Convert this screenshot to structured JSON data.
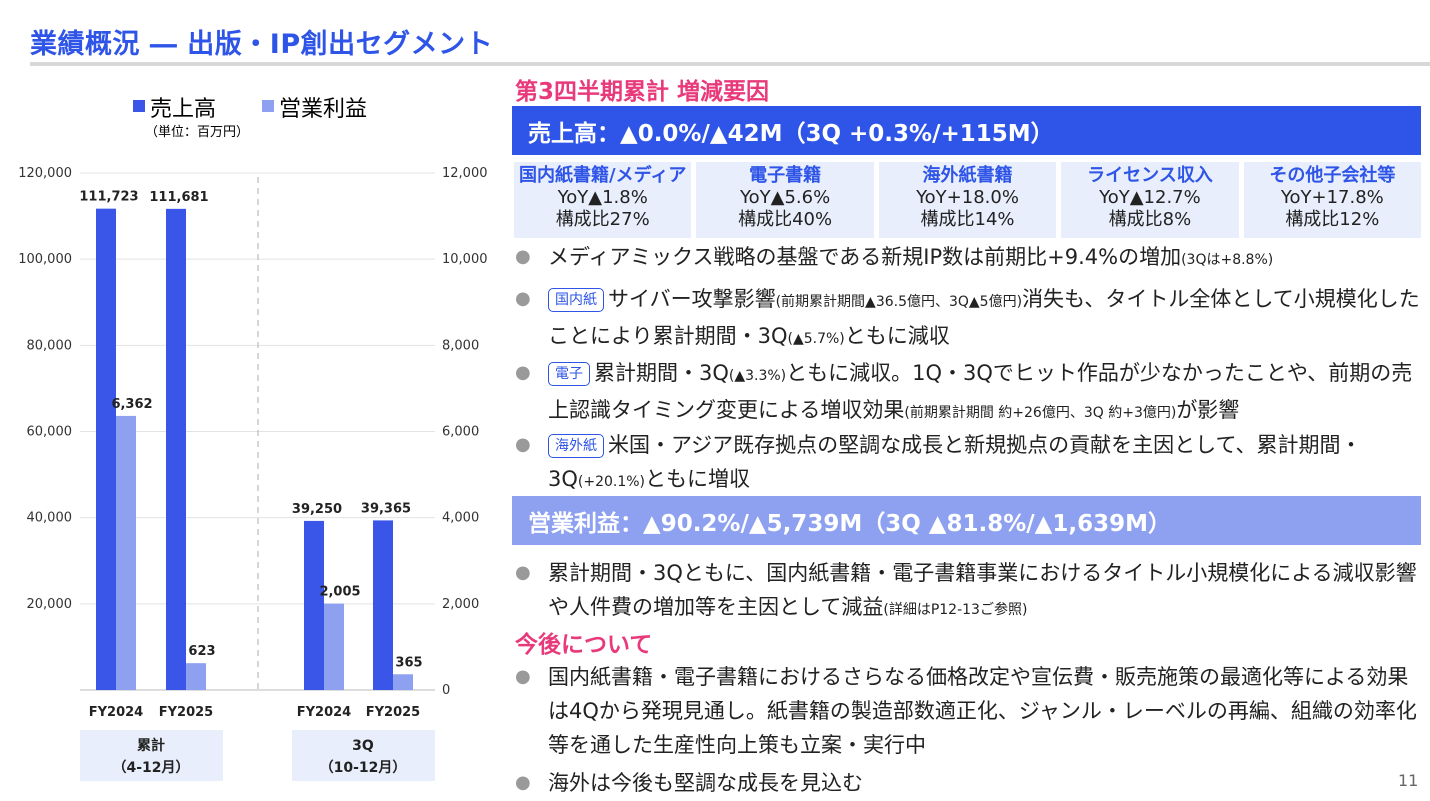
{
  "title": "業績概況 ― 出版・IP創出セグメント",
  "chart": {
    "legend": [
      {
        "name": "売上高",
        "color": "#3a56e8"
      },
      {
        "name": "営業利益",
        "color": "#8ea1f0"
      }
    ],
    "unit": "（単位：百万円）",
    "groups": [
      {
        "label": "累計",
        "sublabel": "（4-12月）"
      },
      {
        "label": "3Q",
        "sublabel": "（10-12月）"
      }
    ]
  },
  "chart_data": {
    "type": "bar",
    "categories": [
      "FY2024",
      "FY2025",
      "FY2024",
      "FY2025"
    ],
    "series": [
      {
        "name": "売上高",
        "axis": "left",
        "values": [
          111723,
          111681,
          39250,
          39365
        ],
        "labels": [
          "111,723",
          "111,681",
          "39,250",
          "39,365"
        ]
      },
      {
        "name": "営業利益",
        "axis": "right",
        "values": [
          6362,
          623,
          2005,
          365
        ],
        "labels": [
          "6,362",
          "623",
          "2,005",
          "365"
        ]
      }
    ],
    "y_left_ticks": [
      "120,000",
      "100,000",
      "80,000",
      "60,000",
      "40,000",
      "20,000"
    ],
    "y_right_ticks": [
      "12,000",
      "10,000",
      "8,000",
      "6,000",
      "4,000",
      "2,000",
      "0"
    ],
    "ylim_left": [
      0,
      120000
    ],
    "ylim_right": [
      0,
      12000
    ],
    "grid": true,
    "legend_position": "top"
  },
  "right": {
    "heading": "第3四半期累計 増減要因",
    "sales_bar": "売上高：▲0.0%/▲42M（3Q +0.3%/+115M）",
    "cells": [
      {
        "name": "国内紙書籍/メディア",
        "yoy": "YoY▲1.8%",
        "share": "構成比27%"
      },
      {
        "name": "電子書籍",
        "yoy": "YoY▲5.6%",
        "share": "構成比40%"
      },
      {
        "name": "海外紙書籍",
        "yoy": "YoY+18.0%",
        "share": "構成比14%"
      },
      {
        "name": "ライセンス収入",
        "yoy": "YoY▲12.7%",
        "share": "構成比8%"
      },
      {
        "name": "その他子会社等",
        "yoy": "YoY+17.8%",
        "share": "構成比12%"
      }
    ],
    "bullets": [
      {
        "tag": "",
        "parts": [
          "メディアミックス戦略の基盤である新規IP数は前期比+9.4%の増加",
          "(3Qは+8.8%)"
        ]
      },
      {
        "tag": "国内紙",
        "parts": [
          "サイバー攻撃影響",
          "(前期累計期間▲36.5億円、3Q▲5億円)",
          "消失も、タイトル全体として小規模化したことにより累計期間・3Q",
          "(▲5.7%)",
          "ともに減収"
        ]
      },
      {
        "tag": "電子",
        "parts": [
          "累計期間・3Q",
          "(▲3.3%)",
          "ともに減収。1Q・3Qでヒット作品が少なかったことや、前期の売上認識タイミング変更による増収効果",
          "(前期累計期間 約+26億円、3Q 約+3億円)",
          "が影響"
        ]
      },
      {
        "tag": "海外紙",
        "parts": [
          "米国・アジア既存拠点の堅調な成長と新規拠点の貢献を主因として、累計期間・3Q",
          "(+20.1%)",
          "ともに増収"
        ]
      }
    ],
    "op_bar": "営業利益：▲90.2%/▲5,739M（3Q ▲81.8%/▲1,639M）",
    "op_bullet": {
      "parts": [
        "累計期間・3Qともに、国内紙書籍・電子書籍事業におけるタイトル小規模化による減収影響や人件費の増加等を主因として減益",
        "(詳細はP12-13ご参照)"
      ]
    },
    "future_heading": "今後について",
    "future_bullets": [
      "国内紙書籍・電子書籍におけるさらなる価格改定や宣伝費・販売施策の最適化等による効果は4Qから発現見通し。紙書籍の製造部数適正化、ジャンル・レーベルの再編、組織の効率化等を通した生産性向上策も立案・実行中",
      "海外は今後も堅調な成長を見込む"
    ]
  },
  "page_number": "11"
}
